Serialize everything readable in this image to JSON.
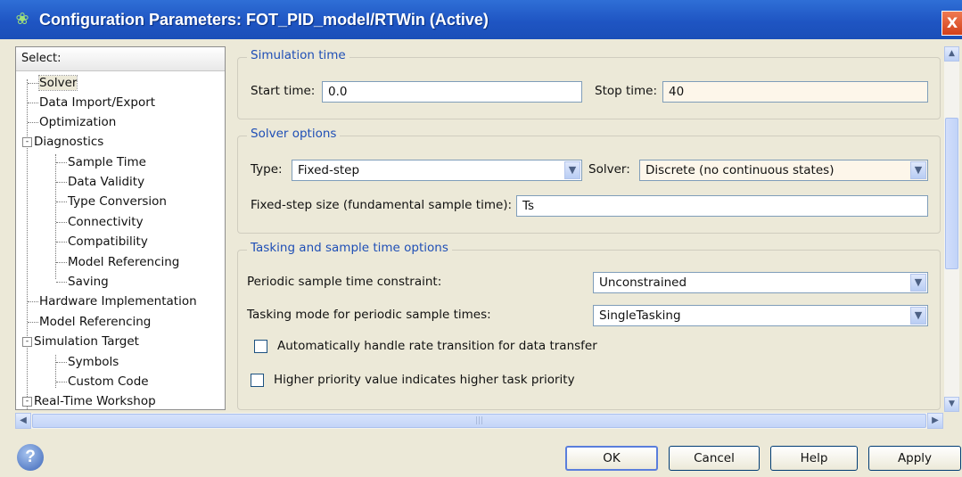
{
  "window": {
    "title": "Configuration Parameters: FOT_PID_model/RTWin (Active)",
    "icon": "simulink-icon",
    "close_label": "X"
  },
  "tree": {
    "header": "Select:",
    "items": [
      {
        "label": "Solver",
        "selected": true
      },
      {
        "label": "Data Import/Export"
      },
      {
        "label": "Optimization"
      },
      {
        "label": "Diagnostics",
        "toggle": "-"
      },
      {
        "label": "Sample Time"
      },
      {
        "label": "Data Validity"
      },
      {
        "label": "Type Conversion"
      },
      {
        "label": "Connectivity"
      },
      {
        "label": "Compatibility"
      },
      {
        "label": "Model Referencing"
      },
      {
        "label": "Saving"
      },
      {
        "label": "Hardware Implementation"
      },
      {
        "label": "Model Referencing"
      },
      {
        "label": "Simulation Target",
        "toggle": "-"
      },
      {
        "label": "Symbols"
      },
      {
        "label": "Custom Code"
      },
      {
        "label": "Real-Time Workshop",
        "toggle": "-"
      }
    ]
  },
  "simulation_time": {
    "title": "Simulation time",
    "start_label": "Start time:",
    "start_value": "0.0",
    "stop_label": "Stop time:",
    "stop_value": "40"
  },
  "solver_options": {
    "title": "Solver options",
    "type_label": "Type:",
    "type_value": "Fixed-step",
    "solver_label": "Solver:",
    "solver_value": "Discrete (no continuous states)",
    "step_label": "Fixed-step size (fundamental sample time):",
    "step_value": "Ts"
  },
  "tasking": {
    "title": "Tasking and sample time options",
    "periodic_label": "Periodic sample time constraint:",
    "periodic_value": "Unconstrained",
    "mode_label": "Tasking mode for periodic sample times:",
    "mode_value": "SingleTasking",
    "auto_rate_label": "Automatically handle rate transition for data transfer",
    "auto_rate_checked": false,
    "priority_label": "Higher priority value indicates higher task priority",
    "priority_checked": false
  },
  "buttons": {
    "ok": "OK",
    "cancel": "Cancel",
    "help": "Help",
    "apply": "Apply"
  },
  "help_icon_label": "?",
  "scroll_grip": "|||",
  "colors": {
    "titlebar": "#1f55c3",
    "group_title": "#1f4fb6",
    "dialog_bg": "#ece9d8"
  }
}
